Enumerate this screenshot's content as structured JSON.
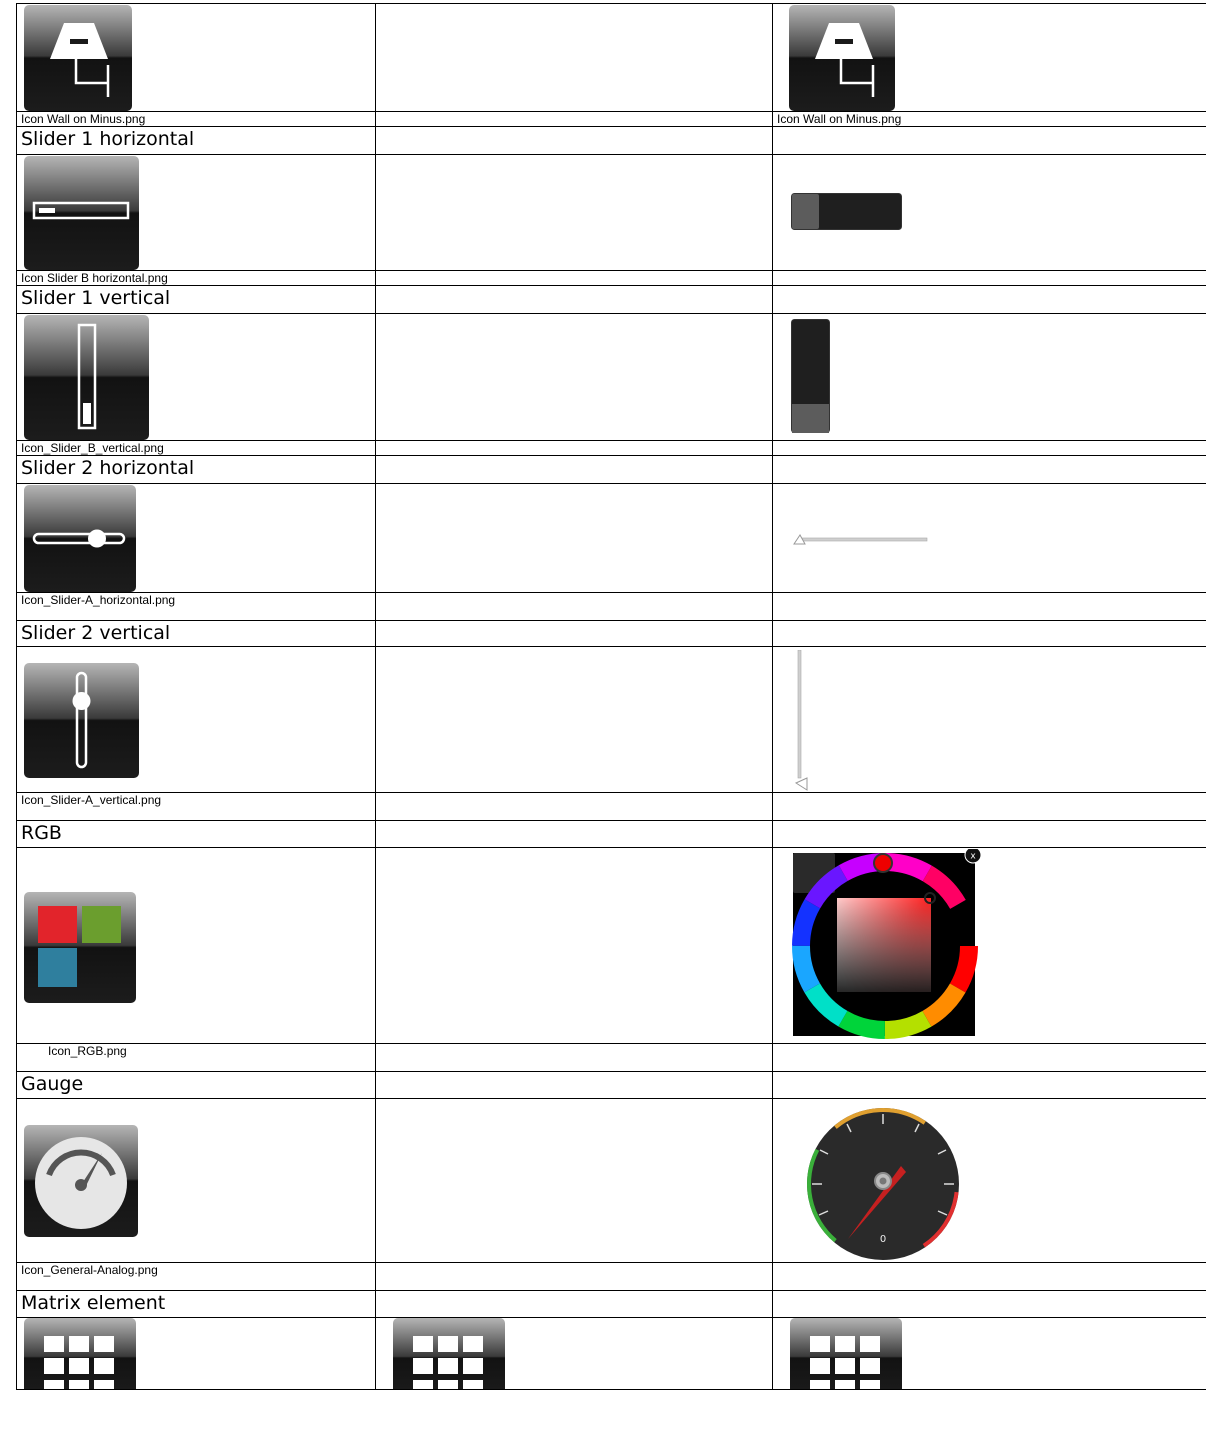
{
  "rows": [
    {
      "caption": "Icon  Wall on Minus.png",
      "caption_right": "Icon  Wall on Minus.png"
    },
    {
      "section": "Slider 1 horizontal",
      "caption": "Icon  Slider  B  horizontal.png"
    },
    {
      "section": "Slider 1 vertical",
      "caption": "Icon_Slider_B_vertical.png"
    },
    {
      "section": "Slider 2 horizontal",
      "caption": "Icon_Slider-A_horizontal.png"
    },
    {
      "section": "Slider 2 vertical",
      "caption": "Icon_Slider-A_vertical.png"
    },
    {
      "section": "RGB",
      "caption": "Icon_RGB.png"
    },
    {
      "section": "Gauge",
      "caption": "Icon_General-Analog.png",
      "gauge_zero": "0"
    },
    {
      "section": "Matrix element"
    }
  ],
  "colors": {
    "icon_dark": "#1a1a1a",
    "red": "#e2242b",
    "green": "#6b9e2e",
    "blue": "#2f7f9e",
    "gauge_needle": "#c62020"
  },
  "icons": [
    "wall-on-minus-icon",
    "slider-horizontal-icon",
    "slider-vertical-icon",
    "slider-a-horizontal-icon",
    "slider-a-vertical-icon",
    "rgb-icon",
    "analog-gauge-icon",
    "matrix-icon"
  ]
}
